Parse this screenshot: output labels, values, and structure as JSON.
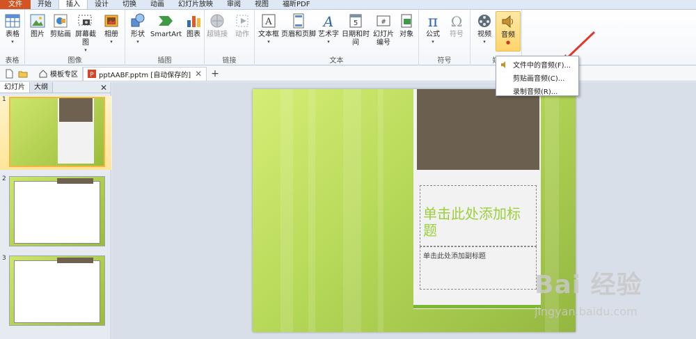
{
  "menu": {
    "tabs": [
      "文件",
      "开始",
      "插入",
      "设计",
      "切换",
      "动画",
      "幻灯片放映",
      "审阅",
      "视图",
      "福昕PDF"
    ],
    "active": "插入"
  },
  "ribbon": {
    "groups": {
      "tables": {
        "label": "表格",
        "buttons": {
          "table": "表格"
        }
      },
      "images": {
        "label": "图像",
        "buttons": {
          "picture": "图片",
          "clipart": "剪贴画",
          "screenshot": "屏幕截图",
          "album": "相册"
        }
      },
      "illustrations": {
        "label": "插图",
        "buttons": {
          "shapes": "形状",
          "smartart": "SmartArt",
          "chart": "图表"
        }
      },
      "links": {
        "label": "链接",
        "buttons": {
          "hyperlink": "超链接",
          "action": "动作"
        }
      },
      "text": {
        "label": "文本",
        "buttons": {
          "textbox": "文本框",
          "header_footer": "页眉和页脚",
          "wordart": "艺术字",
          "datetime": "日期和时间",
          "slide_number_line1": "幻灯片",
          "slide_number_line2": "编号",
          "object": "对象"
        }
      },
      "symbols": {
        "label": "符号",
        "buttons": {
          "equation": "公式",
          "symbol": "符号"
        }
      },
      "media": {
        "label": "媒",
        "buttons": {
          "video": "视频",
          "audio": "音频"
        }
      }
    }
  },
  "doc_tabs": {
    "template_tab": "模板专区",
    "file_tab": "pptAABF.pptm [自动保存的]"
  },
  "panel": {
    "tabs": [
      "幻灯片",
      "大纲"
    ],
    "slide_numbers": [
      "1",
      "2",
      "3"
    ]
  },
  "slide": {
    "title": "单击此处添加标题",
    "subtitle": "单击此处添加副标题"
  },
  "audio_menu": {
    "items": [
      "文件中的音频(F)...",
      "剪贴画音频(C)...",
      "录制音频(R)..."
    ]
  },
  "watermark": {
    "brand": "Bai  经验",
    "url": "jingyan.baidu.com"
  }
}
